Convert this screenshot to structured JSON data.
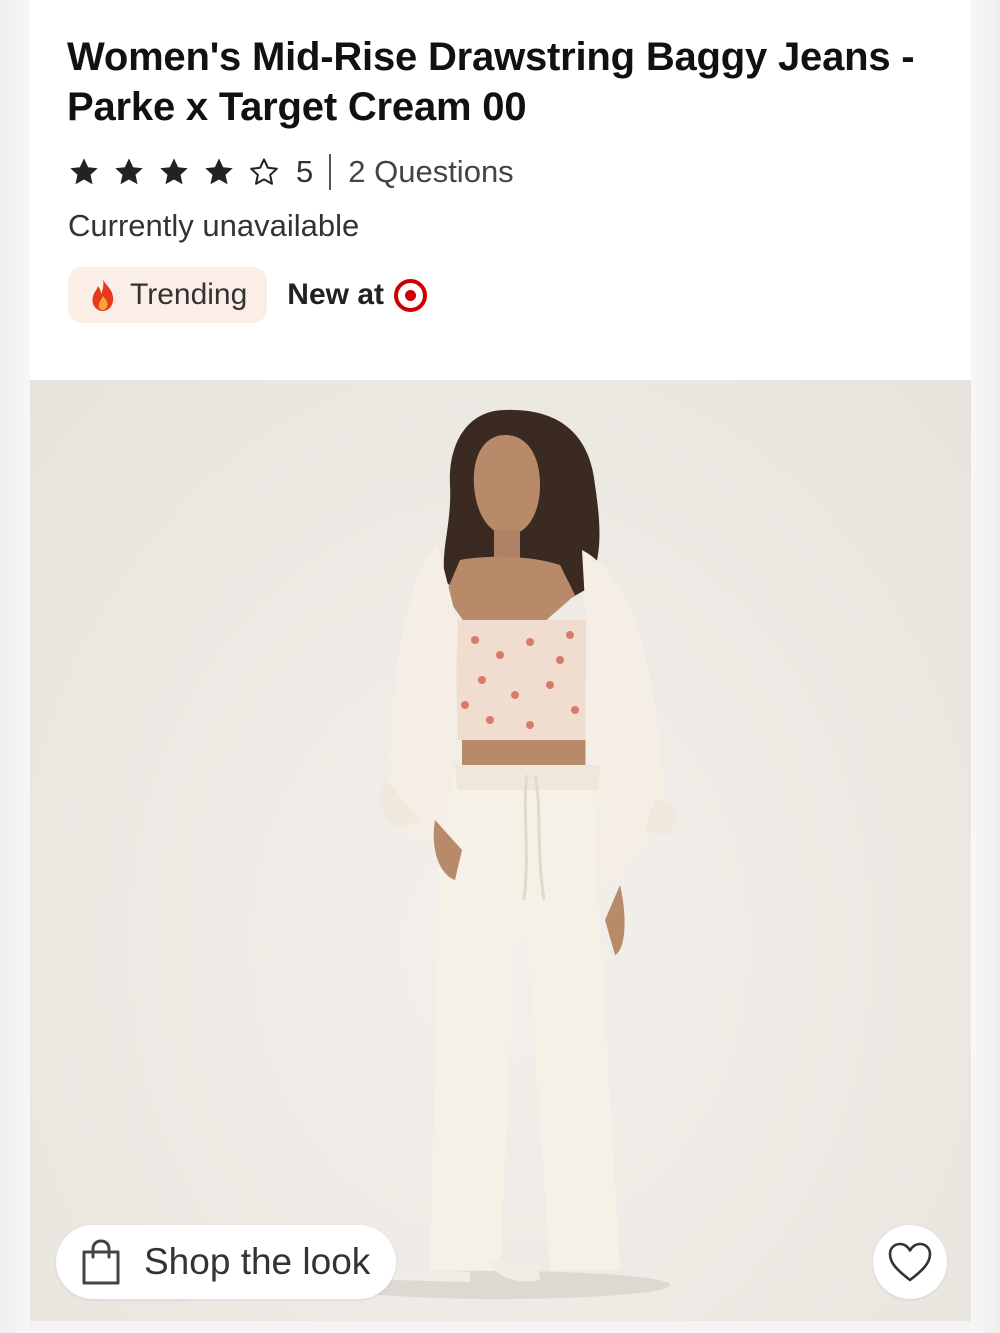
{
  "product": {
    "title": "Women's Mid-Rise Drawstring Baggy Jeans - Parke x Target Cream 00",
    "rating": {
      "stars_filled": 4,
      "stars_total": 5,
      "count": "5",
      "questions_label": "2 Questions"
    },
    "availability": "Currently unavailable",
    "badges": {
      "trending_label": "Trending",
      "trending_icon": "flame-icon",
      "new_at_label": "New at",
      "new_at_icon": "target-logo-icon"
    }
  },
  "image": {
    "shop_the_look_label": "Shop the look",
    "shop_icon": "shopping-bag-icon",
    "favorite_icon": "heart-outline-icon"
  },
  "colors": {
    "accent_red": "#cc0000",
    "trending_bg": "#fbeee6",
    "photo_bg": "#ebe7e1"
  }
}
